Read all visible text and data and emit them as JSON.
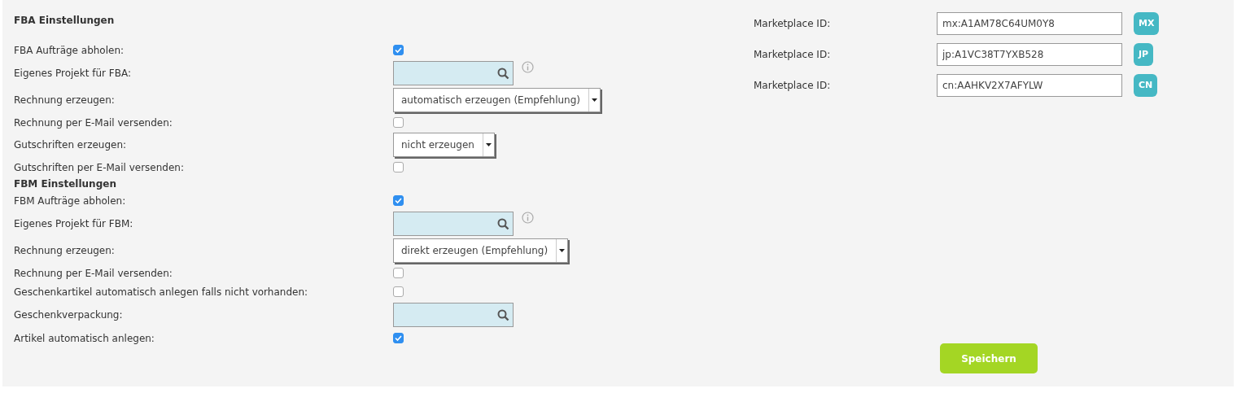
{
  "sections": [
    {
      "title": "FBA Einstellungen",
      "rows": [
        {
          "kind": "checkbox",
          "label": "FBA Aufträge abholen:",
          "checked": true
        },
        {
          "kind": "search",
          "label": "Eigenes Projekt für FBA:",
          "info": true
        },
        {
          "kind": "select",
          "label": "Rechnung erzeugen:",
          "value": "automatisch erzeugen (Empfehlung)"
        },
        {
          "kind": "checkbox",
          "label": "Rechnung per E-Mail versenden:",
          "checked": false
        },
        {
          "kind": "select",
          "label": "Gutschriften erzeugen:",
          "value": "nicht erzeugen"
        },
        {
          "kind": "checkbox",
          "label": "Gutschriften per E-Mail versenden:",
          "checked": false
        }
      ]
    },
    {
      "title": "FBM Einstellungen",
      "rows": [
        {
          "kind": "checkbox",
          "label": "FBM Aufträge abholen:",
          "checked": true
        },
        {
          "kind": "search",
          "label": "Eigenes Projekt für FBM:",
          "info": true
        },
        {
          "kind": "select",
          "label": "Rechnung erzeugen:",
          "value": "direkt erzeugen (Empfehlung)"
        },
        {
          "kind": "checkbox",
          "label": "Rechnung per E-Mail versenden:",
          "checked": false
        },
        {
          "kind": "checkbox",
          "label": "Geschenkartikel automatisch anlegen falls nicht vorhanden:",
          "checked": false
        },
        {
          "kind": "search",
          "label": "Geschenkverpackung:",
          "info": false
        },
        {
          "kind": "checkbox",
          "label": "Artikel automatisch anlegen:",
          "checked": true
        }
      ]
    }
  ],
  "marketplaces": [
    {
      "label": "Marketplace ID:",
      "value": "mx:A1AM78C64UM0Y8",
      "code": "MX"
    },
    {
      "label": "Marketplace ID:",
      "value": "jp:A1VC38T7YXB528",
      "code": "JP"
    },
    {
      "label": "Marketplace ID:",
      "value": "cn:AAHKV2X7AFYLW",
      "code": "CN"
    }
  ],
  "save_button": "Speichern"
}
